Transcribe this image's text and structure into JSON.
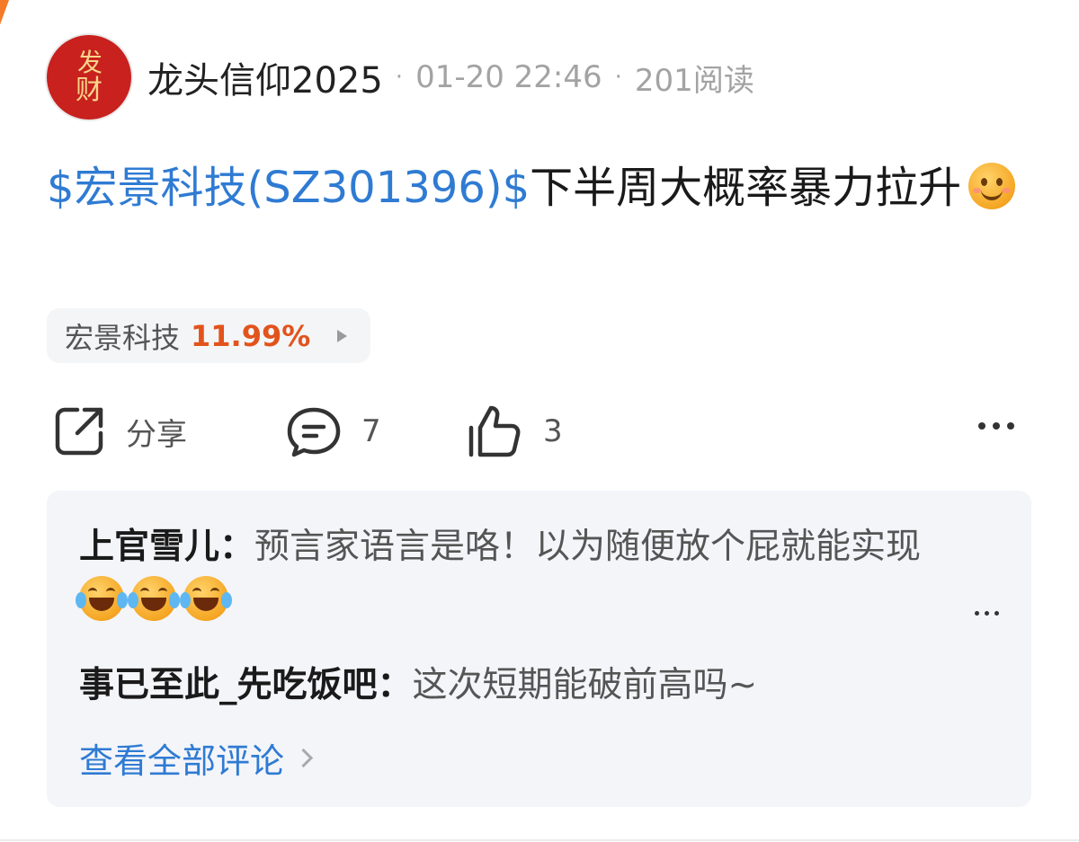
{
  "post": {
    "author": "龙头信仰2025",
    "avatar_text_line1": "发",
    "avatar_text_line2": "财",
    "date": "01-20 22:46",
    "views": "201阅读",
    "stock_link": "$宏景科技(SZ301396)$",
    "text": "下半周大概率暴力拉升",
    "emoji": "smile-emoji"
  },
  "stock_chip": {
    "name": "宏景科技",
    "change": "11.99%",
    "change_color": "#e2531c"
  },
  "actions": {
    "share_label": "分享",
    "comment_count": "7",
    "like_count": "3"
  },
  "comments": [
    {
      "name": "上官雪儿",
      "sep": "：",
      "text": "预言家语言是咯！以为随便放个屁就能实现",
      "emoji": [
        "laughing-emoji",
        "laughing-emoji",
        "laughing-emoji"
      ]
    },
    {
      "name": "事已至此_先吃饭吧",
      "sep": "：",
      "text": "这次短期能破前高吗~"
    }
  ],
  "view_all_comments": "查看全部评论",
  "colors": {
    "link": "#2f7bd3",
    "accent_orange": "#f47a2a",
    "avatar_red": "#c8211e"
  }
}
